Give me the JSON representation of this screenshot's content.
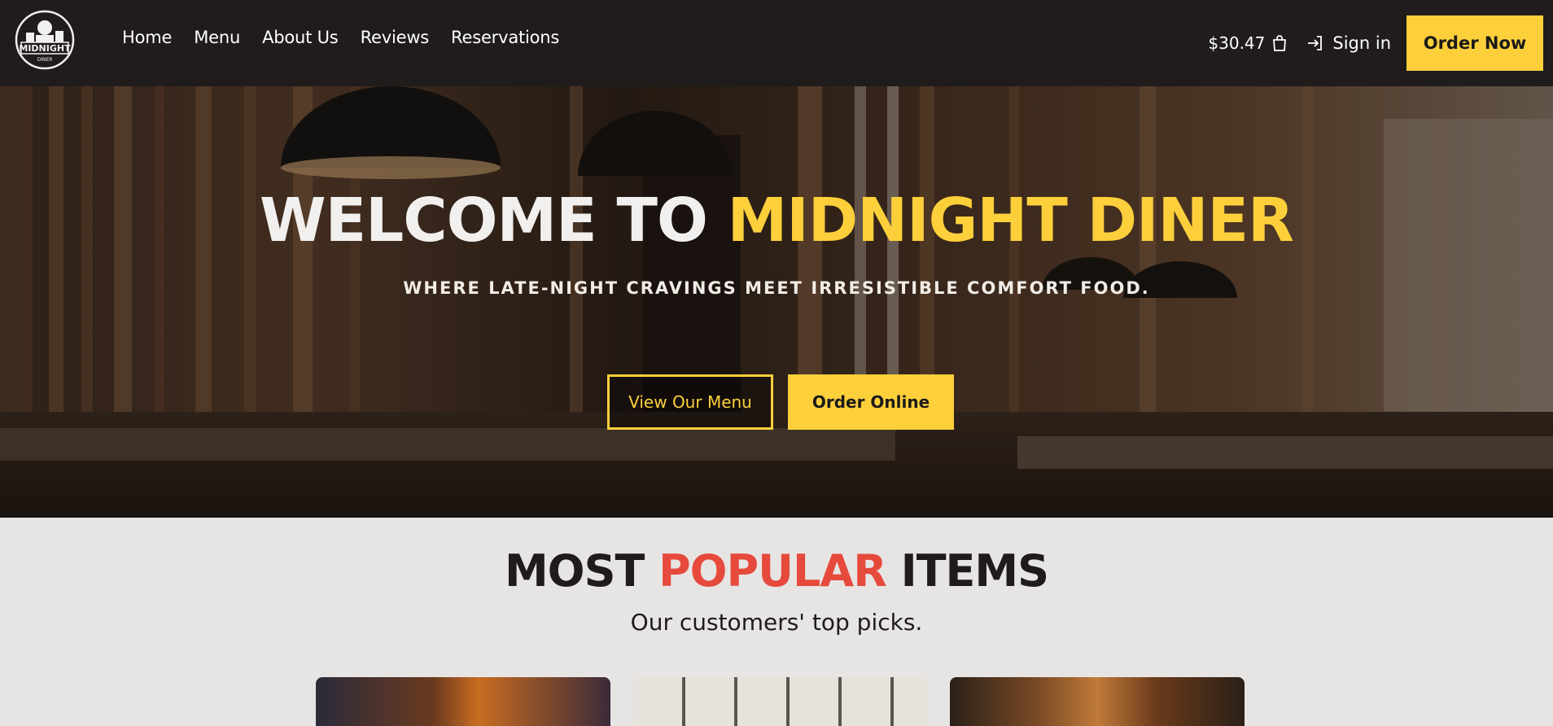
{
  "brand": {
    "logo_text": "MIDNIGHT",
    "logo_subtext": "DINER"
  },
  "nav": {
    "links": [
      "Home",
      "Menu",
      "About Us",
      "Reviews",
      "Reservations"
    ],
    "cart_total": "$30.47",
    "sign_in": "Sign in",
    "order_now": "Order Now"
  },
  "hero": {
    "title_part1": "WELCOME TO ",
    "title_part2": "MIDNIGHT DINER",
    "subtitle": "WHERE LATE-NIGHT CRAVINGS MEET IRRESISTIBLE COMFORT FOOD.",
    "btn_menu": "View Our Menu",
    "btn_order": "Order Online"
  },
  "popular": {
    "title_part1": "MOST ",
    "title_part2": "POPULAR",
    "title_part3": " ITEMS",
    "subtitle": "Our customers' top picks."
  },
  "colors": {
    "accent": "#fdd03b",
    "highlight": "#e64a3d",
    "nav_bg": "#1f1c1b",
    "page_bg": "#e7e5e4"
  },
  "icons": {
    "cart": "shopping-bag-icon",
    "sign_in": "login-arrow-icon"
  }
}
